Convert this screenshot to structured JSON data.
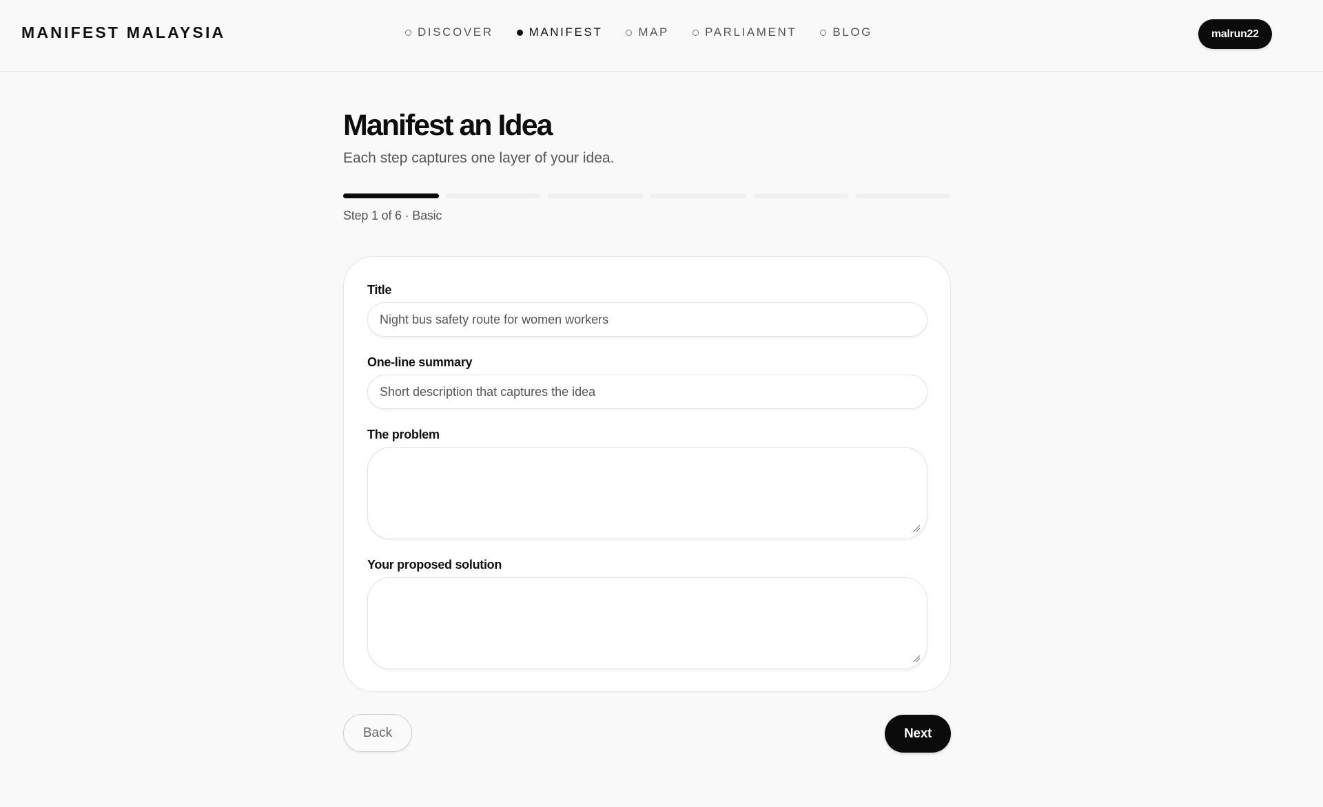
{
  "header": {
    "brand": "MANIFEST MALAYSIA",
    "nav": [
      {
        "label": "DISCOVER",
        "active": false
      },
      {
        "label": "MANIFEST",
        "active": true
      },
      {
        "label": "MAP",
        "active": false
      },
      {
        "label": "PARLIAMENT",
        "active": false
      },
      {
        "label": "BLOG",
        "active": false
      }
    ],
    "user": "malrun22"
  },
  "page": {
    "title": "Manifest an Idea",
    "subtitle": "Each step captures one layer of your idea."
  },
  "progress": {
    "current_step": 1,
    "total_steps": 6,
    "label": "Step 1 of 6 · Basic"
  },
  "form": {
    "title": {
      "label": "Title",
      "placeholder": "Night bus safety route for women workers",
      "value": ""
    },
    "summary": {
      "label": "One-line summary",
      "placeholder": "Short description that captures the idea",
      "value": ""
    },
    "problem": {
      "label": "The problem",
      "value": ""
    },
    "solution": {
      "label": "Your proposed solution",
      "value": ""
    }
  },
  "actions": {
    "back_label": "Back",
    "next_label": "Next"
  },
  "colors": {
    "accent": "#0b0b0b",
    "background": "#f9f9f9",
    "card": "#ffffff"
  }
}
